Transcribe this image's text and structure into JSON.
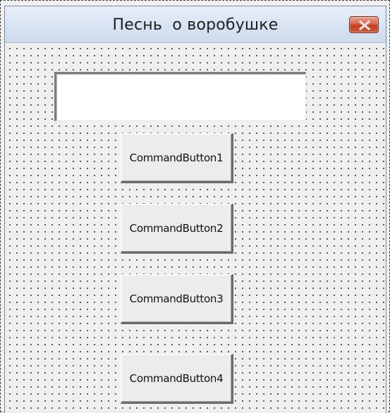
{
  "window": {
    "title": "Песнь  о воробушке",
    "close_icon": "close-icon"
  },
  "form": {
    "textbox_value": "",
    "buttons": [
      {
        "label": "CommandButton1"
      },
      {
        "label": "CommandButton2"
      },
      {
        "label": "CommandButton3"
      },
      {
        "label": "CommandButton4"
      }
    ]
  },
  "colors": {
    "titlebar": "#dbe5f3",
    "close_button": "#c0401f",
    "client_background": "#efefef",
    "grid_dots": "#333333"
  }
}
